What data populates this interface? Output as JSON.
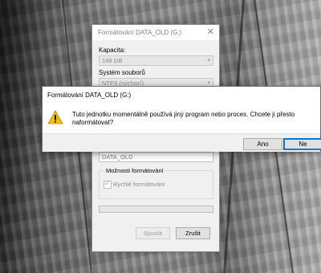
{
  "format_dialog": {
    "title": "Formátování DATA_OLD (G:)",
    "capacity_label": "Kapacita:",
    "capacity_value": "148 GB",
    "filesystem_label": "Systém souborů",
    "filesystem_value": "NTFS (výchozí)",
    "volume_label_value": "DATA_OLD",
    "format_options_label": "Možnosti formátování",
    "quick_format_label": "Rychlé formátování",
    "quick_format_checked": true,
    "start_button": "Spustit",
    "close_button": "Zrušit"
  },
  "alert_dialog": {
    "title": "Formátování DATA_OLD (G:)",
    "message": "Tuto jednotku momentálně používá jiný program nebo proces. Chcete ji přesto naformátovat?",
    "icon": "warning-icon",
    "yes_button": "Ano",
    "no_button": "Ne"
  },
  "colors": {
    "warning": "#f2c200",
    "focus_border": "#0078d7"
  }
}
